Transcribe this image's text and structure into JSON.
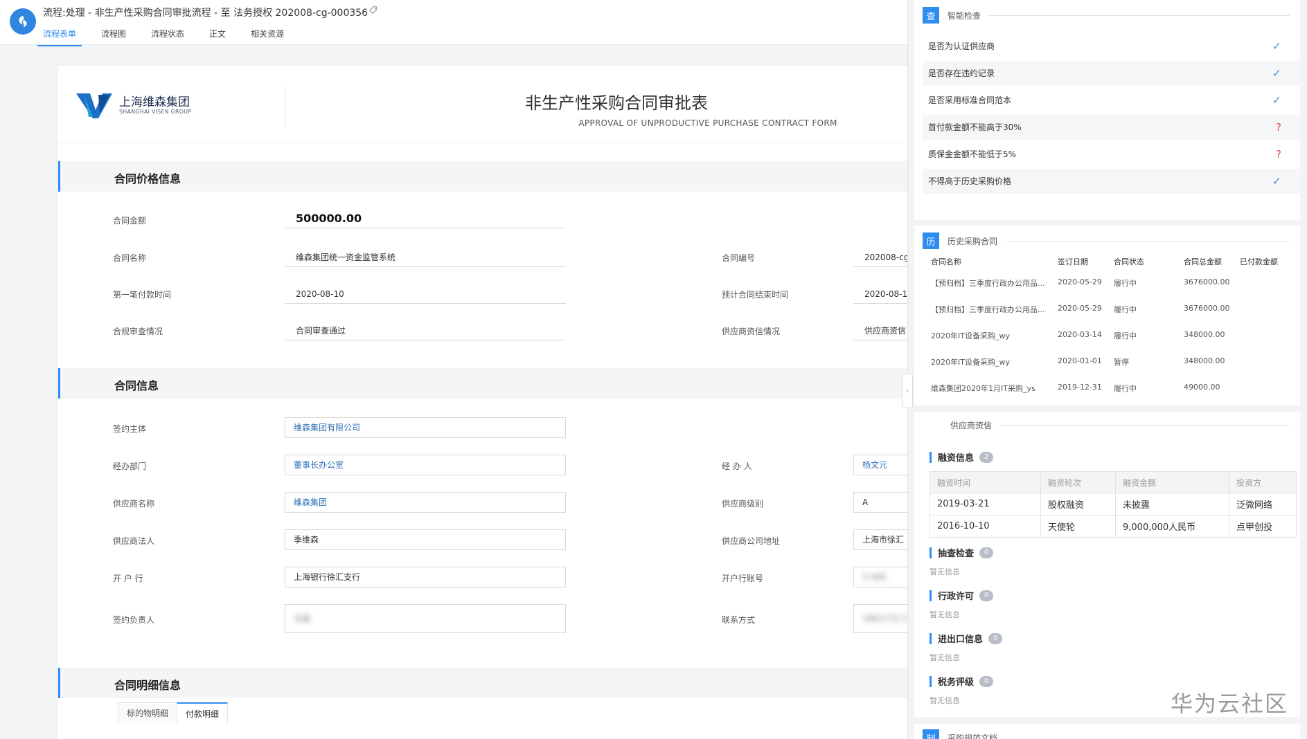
{
  "window": {
    "title": "流程:处理 - 非生产性采购合同审批流程 - 至 法务授权 202008-cg-000356",
    "tabs": [
      "流程表单",
      "流程图",
      "流程状态",
      "正文",
      "相关资源"
    ]
  },
  "form": {
    "company_name_cn": "上海维森集团",
    "company_name_en": "SHANGHAI VISEN GROUP",
    "title": "非生产性采购合同审批表",
    "subtitle": "APPROVAL OF UNPRODUCTIVE PURCHASE CONTRACT FORM",
    "sections": {
      "price": "合同价格信息",
      "contract": "合同信息",
      "detail": "合同明细信息"
    },
    "price_fields": {
      "amount_label": "合同金额",
      "amount_value": "500000.00",
      "name_label": "合同名称",
      "name_value": "维森集团统一资金监管系统",
      "number_label": "合同编号",
      "number_value": "202008-cg",
      "first_pay_label": "第一笔付款时间",
      "first_pay_value": "2020-08-10",
      "end_label": "预计合同结束时间",
      "end_value": "2020-08-1",
      "compliance_label": "合规审查情况",
      "compliance_value": "合同审查通过",
      "credit_label": "供应商资信情况",
      "credit_value": "供应商资信"
    },
    "contract_fields": {
      "party_label": "签约主体",
      "party_value": "维森集团有限公司",
      "dept_label": "经办部门",
      "dept_value": "董事长办公室",
      "handler_label": "经 办 人",
      "handler_value": "杨文元",
      "supplier_label": "供应商名称",
      "supplier_value": "维森集团",
      "level_label": "供应商级别",
      "level_value": "A",
      "legal_label": "供应商法人",
      "legal_value": "季维森",
      "address_label": "供应商公司地址",
      "address_value": "上海市徐汇",
      "bank_label": "开 户 行",
      "bank_value": "上海银行徐汇支行",
      "account_label": "开户行账号",
      "account_value": "3      400",
      "signer_label": "签约负责人",
      "signer_value": "王森",
      "contact_label": "联系方式",
      "contact_value": "1861772 5"
    },
    "detail_tabs": [
      "标的物明细",
      "付款明细"
    ],
    "detail_active_tab": "付款明细"
  },
  "smart_check": {
    "badge": "查",
    "title": "智能检查",
    "items": [
      {
        "label": "是否为认证供应商",
        "mark": "✓"
      },
      {
        "label": "是否存在违约记录",
        "mark": "✓"
      },
      {
        "label": "是否采用标准合同范本",
        "mark": "✓"
      },
      {
        "label": "首付款金额不能高于30%",
        "mark": "?"
      },
      {
        "label": "质保金金额不能低于5%",
        "mark": "?"
      },
      {
        "label": "不得高于历史采购价格",
        "mark": "✓"
      }
    ]
  },
  "history": {
    "badge": "历",
    "title": "历史采购合同",
    "columns": [
      "合同名称",
      "签订日期",
      "合同状态",
      "合同总金额",
      "已付款金额"
    ],
    "rows": [
      [
        "【预归档】三季度行政办公用品...",
        "2020-05-29",
        "履行中",
        "3676000.00",
        ""
      ],
      [
        "【预归档】三季度行政办公用品...",
        "2020-05-29",
        "履行中",
        "3676000.00",
        ""
      ],
      [
        "2020年IT设备采购_wy",
        "2020-03-14",
        "履行中",
        "348000.00",
        ""
      ],
      [
        "2020年IT设备采购_wy",
        "2020-01-01",
        "暂停",
        "348000.00",
        ""
      ],
      [
        "维森集团2020年1月IT采购_ys",
        "2019-12-31",
        "履行中",
        "49000.00",
        ""
      ]
    ]
  },
  "supplier_credit": {
    "title": "供应商资信",
    "financing": {
      "title": "融资信息",
      "count": "2",
      "columns": [
        "融资时间",
        "融资轮次",
        "融资金额",
        "投资方"
      ],
      "rows": [
        [
          "2019-03-21",
          "股权融资",
          "未披露",
          "泛微网络"
        ],
        [
          "2016-10-10",
          "天使轮",
          "9,000,000人民币",
          "点甲创投"
        ]
      ]
    },
    "spot_check": {
      "title": "抽查检查",
      "count": "0",
      "empty": "暂无信息"
    },
    "license": {
      "title": "行政许可",
      "count": "0",
      "empty": "暂无信息"
    },
    "import_export": {
      "title": "进出口信息",
      "count": "0",
      "empty": "暂无信息"
    },
    "tax": {
      "title": "税务评级",
      "count": "0",
      "empty": "暂无信息"
    }
  },
  "bottom_card": {
    "badge": "制",
    "title": "采购规范文档"
  },
  "watermark": "华为云社区",
  "colors": {
    "accent": "#2d8cf0",
    "check": "#4a90d9",
    "warning": "#e04a4a"
  }
}
